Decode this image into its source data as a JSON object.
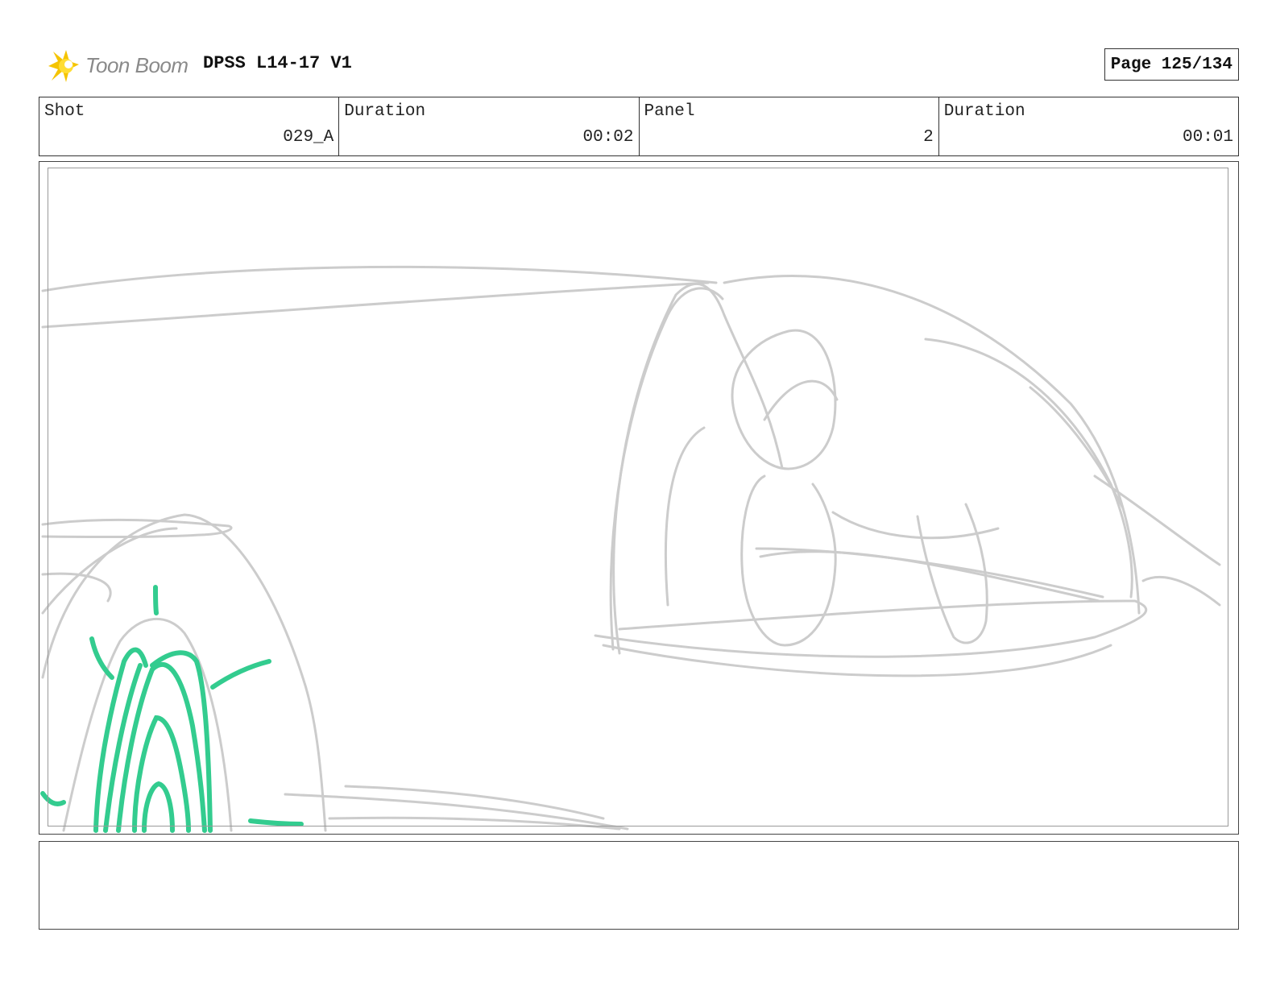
{
  "header": {
    "logo_text": "Toon Boom",
    "document_title": "DPSS L14-17 V1",
    "page_label": "Page 125/134"
  },
  "info": {
    "shot_label": "Shot",
    "shot_value": "029_A",
    "shot_duration_label": "Duration",
    "shot_duration_value": "00:02",
    "panel_label": "Panel",
    "panel_value": "2",
    "panel_duration_label": "Duration",
    "panel_duration_value": "00:01"
  },
  "colors": {
    "sketch_gray": "#cccccc",
    "sketch_green": "#33cc8f",
    "logo_yellow": "#f5c400"
  },
  "notes": {
    "text": ""
  }
}
